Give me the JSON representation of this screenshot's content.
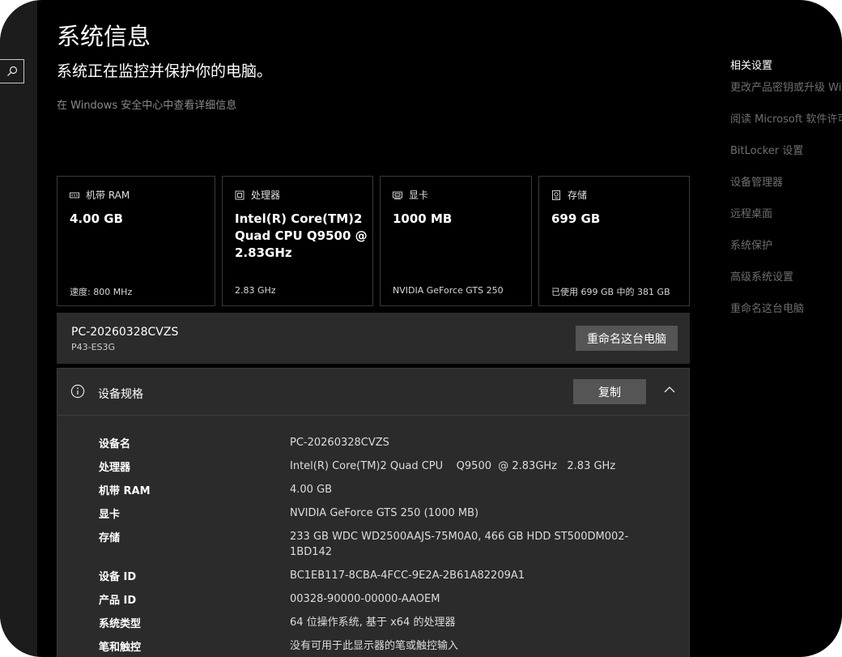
{
  "header": {
    "title": "系统信息",
    "subtitle": "系统正在监控并保护你的电脑。",
    "detail_link": "在 Windows 安全中心中查看详细信息"
  },
  "cards": [
    {
      "label": "机带 RAM",
      "icon": "memory-icon",
      "value": "4.00 GB",
      "footer": "速度: 800 MHz"
    },
    {
      "label": "处理器",
      "icon": "processor-icon",
      "value": "Intel(R) Core(TM)2 Quad CPU    Q9500  @ 2.83GHz",
      "footer": "2.83 GHz"
    },
    {
      "label": "显卡",
      "icon": "display-card-icon",
      "value": "1000 MB",
      "footer": "NVIDIA GeForce GTS 250"
    },
    {
      "label": "存储",
      "icon": "storage-icon",
      "value": "699 GB",
      "footer": "已使用 699 GB 中的 381 GB"
    }
  ],
  "device": {
    "name": "PC-20260328CVZS",
    "model": "P43-ES3G",
    "rename_label": "重命名这台电脑"
  },
  "specs": {
    "title": "设备规格",
    "copy_label": "复制",
    "rows": [
      {
        "key": "设备名",
        "value": "PC-20260328CVZS"
      },
      {
        "key": "处理器",
        "value": "Intel(R) Core(TM)2 Quad CPU    Q9500  @ 2.83GHz   2.83 GHz"
      },
      {
        "key": "机带 RAM",
        "value": "4.00 GB"
      },
      {
        "key": "显卡",
        "value": "NVIDIA GeForce GTS 250 (1000 MB)"
      },
      {
        "key": "存储",
        "value": "233 GB WDC WD2500AAJS-75M0A0, 466 GB HDD ST500DM002-1BD142"
      },
      {
        "key": "设备 ID",
        "value": "BC1EB117-8CBA-4FCC-9E2A-2B61A82209A1"
      },
      {
        "key": "产品 ID",
        "value": "00328-90000-00000-AAOEM"
      },
      {
        "key": "系统类型",
        "value": "64 位操作系统, 基于 x64 的处理器"
      },
      {
        "key": "笔和触控",
        "value": "没有可用于此显示器的笔或触控输入"
      }
    ]
  },
  "related": {
    "title": "相关设置",
    "links": [
      "更改产品密钥或升级 Windows",
      "阅读 Microsoft 软件许可条款",
      "BitLocker 设置",
      "设备管理器",
      "远程桌面",
      "系统保护",
      "高级系统设置",
      "重命名这台电脑"
    ]
  },
  "colors": {
    "background": "#000000",
    "panel": "#2b2b2b",
    "button": "#555555",
    "muted_text": "#8a8a8a",
    "link_text": "#6e6e6e"
  }
}
